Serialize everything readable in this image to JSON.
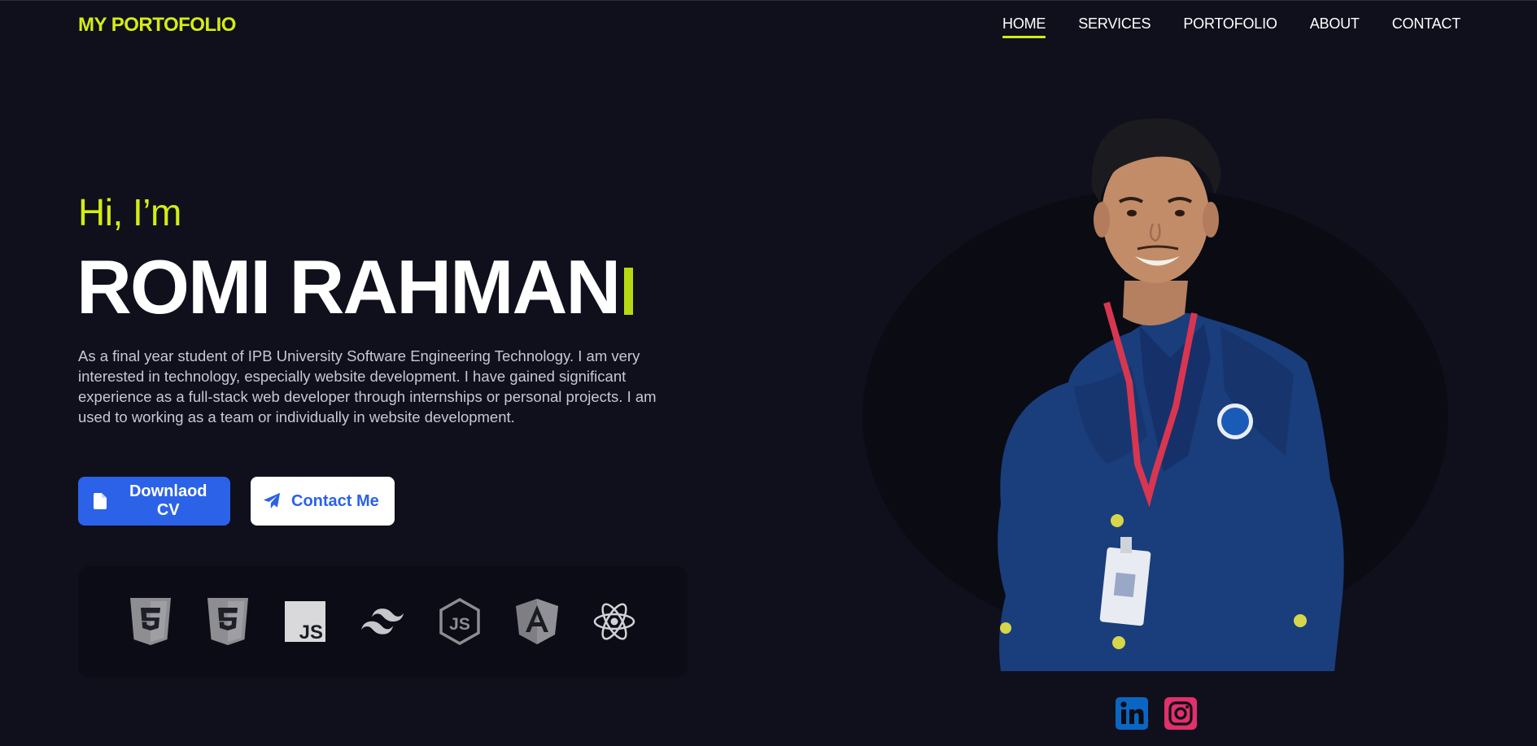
{
  "brand": {
    "logo": "MY PORTOFOLIO",
    "accent": "#d4ed13"
  },
  "nav": {
    "items": [
      {
        "label": "HOME",
        "active": true
      },
      {
        "label": "SERVICES",
        "active": false
      },
      {
        "label": "PORTOFOLIO",
        "active": false
      },
      {
        "label": "ABOUT",
        "active": false
      },
      {
        "label": "CONTACT",
        "active": false
      }
    ]
  },
  "hero": {
    "greeting": "Hi, I’m",
    "name": "ROMI RAHMAN",
    "bio": "As a final year student of IPB University Software Engineering Technology. I am very interested in technology, especially website development. I have gained significant experience as a full-stack web developer through internships or personal projects. I am used to working as a team or individually in website development."
  },
  "buttons": {
    "cv": {
      "label": "Downlaod CV",
      "icon": "file-icon",
      "color": "#2b62e8"
    },
    "contact": {
      "label": "Contact Me",
      "icon": "paper-plane-icon"
    }
  },
  "tech_stack": [
    "html5-icon",
    "css3-icon",
    "javascript-icon",
    "tailwind-icon",
    "nodejs-icon",
    "angular-icon",
    "react-icon"
  ],
  "social": [
    {
      "icon": "linkedin-icon",
      "color": "#0a66c2"
    },
    {
      "icon": "instagram-icon",
      "color": "#e1306c"
    }
  ]
}
